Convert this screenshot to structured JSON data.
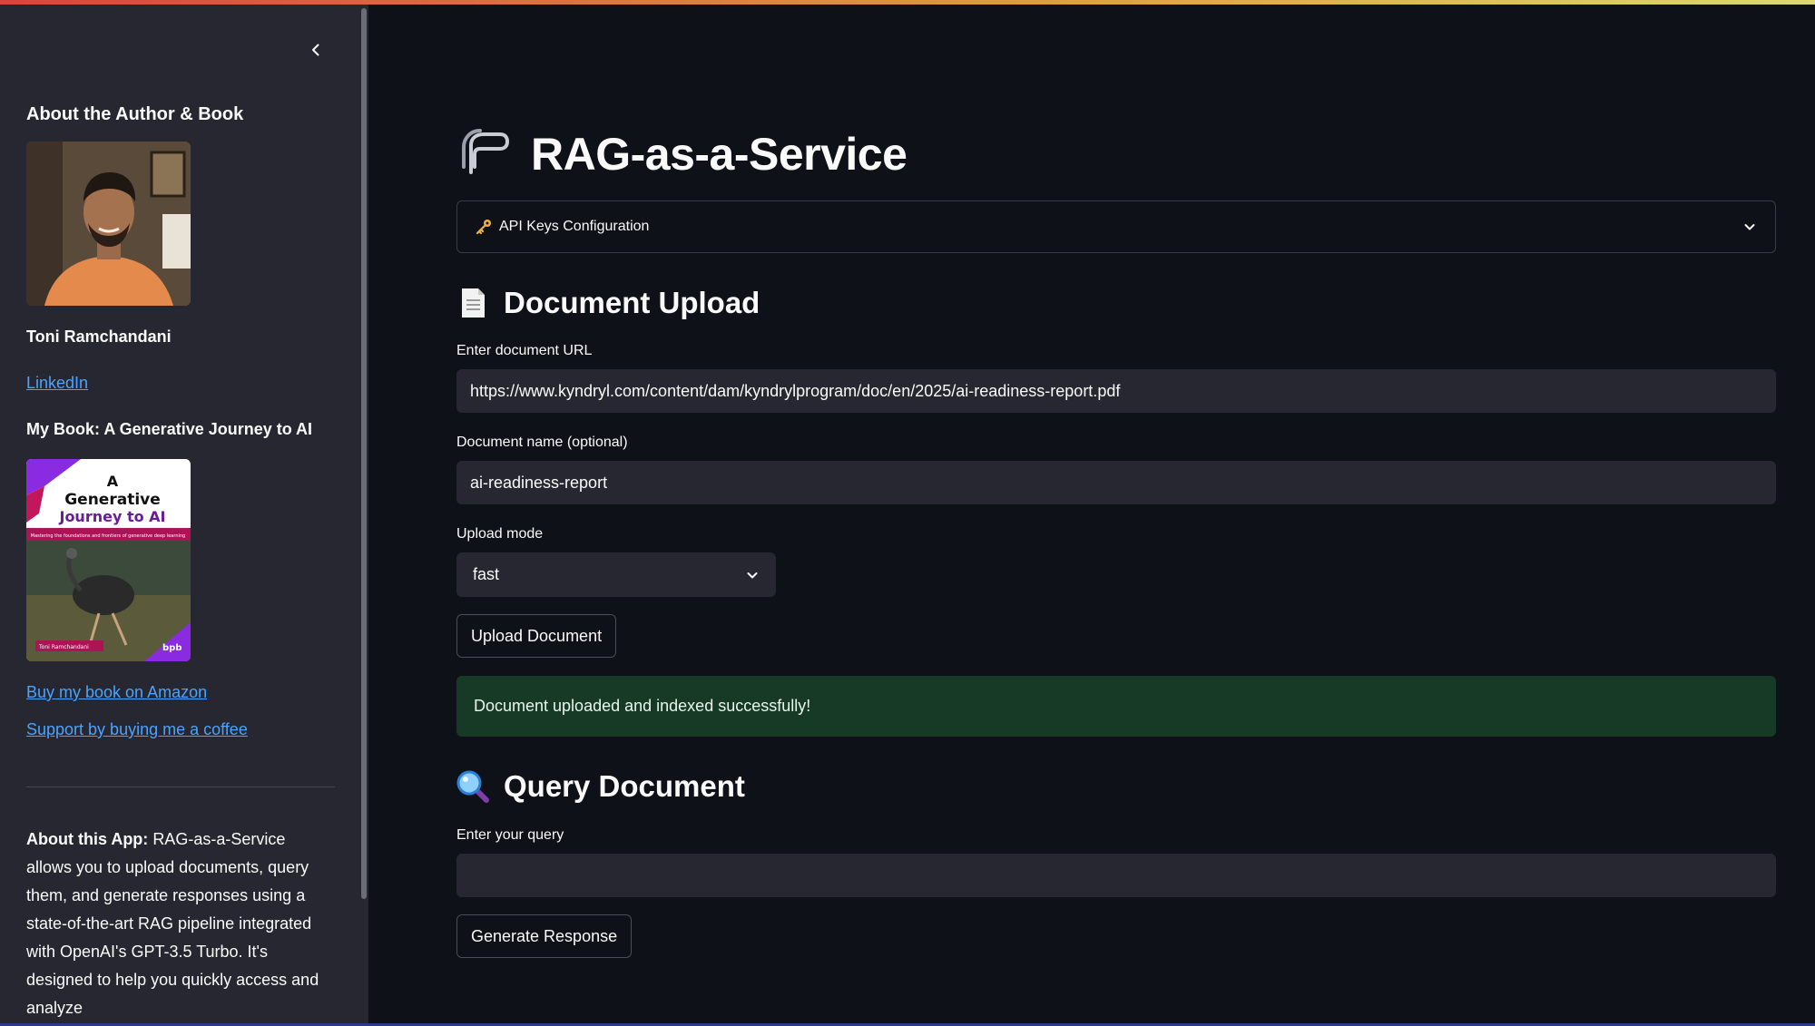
{
  "sidebar": {
    "about_heading": "About the Author & Book",
    "author_name": "Toni Ramchandani",
    "linkedin_label": "LinkedIn",
    "book_heading": "My Book: A Generative Journey to AI",
    "book_cover": {
      "line1": "A",
      "line2": "Generative",
      "line3": "Journey to AI",
      "subtitle": "Mastering the foundations and frontiers of generative deep learning",
      "author": "Toni Ramchandani",
      "publisher": "bpb"
    },
    "amazon_link": "Buy my book on Amazon",
    "coffee_link": "Support by buying me a coffee",
    "about_app_bold": "About this App:",
    "about_app_text": "RAG-as-a-Service allows you to upload documents, query them, and generate responses using a state-of-the-art RAG pipeline integrated with OpenAI's GPT-3.5 Turbo. It's designed to help you quickly access and analyze"
  },
  "main": {
    "title": "RAG-as-a-Service",
    "title_icon": "paperclip-icon",
    "expander_label": "API Keys Configuration",
    "expander_icon": "key-icon",
    "upload": {
      "heading": "Document Upload",
      "heading_icon": "page-icon",
      "url_label": "Enter document URL",
      "url_value": "https://www.kyndryl.com/content/dam/kyndrylprogram/doc/en/2025/ai-readiness-report.pdf",
      "name_label": "Document name (optional)",
      "name_value": "ai-readiness-report",
      "mode_label": "Upload mode",
      "mode_value": "fast",
      "button_label": "Upload Document",
      "success_message": "Document uploaded and indexed successfully!"
    },
    "query": {
      "heading": "Query Document",
      "heading_icon": "magnifier-icon",
      "query_label": "Enter your query",
      "query_value": "",
      "button_label": "Generate Response"
    }
  },
  "colors": {
    "background": "#0e1117",
    "sidebar": "#262730",
    "input": "#262730",
    "link": "#4aa3ff",
    "success_bg": "#173a26"
  }
}
